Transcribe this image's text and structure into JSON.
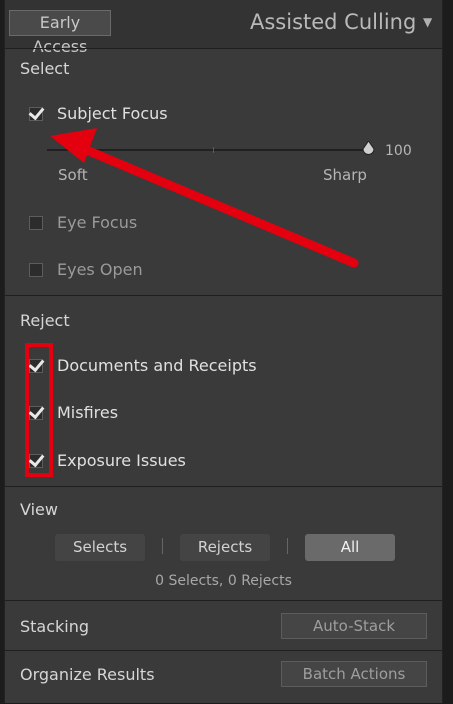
{
  "header": {
    "badge": "Early Access",
    "title": "Assisted Culling",
    "collapse_glyph": "▼"
  },
  "select": {
    "label": "Select",
    "items": [
      {
        "label": "Subject Focus",
        "checked": true,
        "enabled": true
      },
      {
        "label": "Eye Focus",
        "checked": false,
        "enabled": false
      },
      {
        "label": "Eyes Open",
        "checked": false,
        "enabled": false
      }
    ],
    "slider": {
      "value_label": "100",
      "value": 100,
      "min_label": "Soft",
      "max_label": "Sharp"
    }
  },
  "reject": {
    "label": "Reject",
    "items": [
      {
        "label": "Documents and Receipts",
        "checked": true
      },
      {
        "label": "Misfires",
        "checked": true
      },
      {
        "label": "Exposure Issues",
        "checked": true
      }
    ]
  },
  "view": {
    "label": "View",
    "buttons": [
      {
        "label": "Selects",
        "active": false
      },
      {
        "label": "Rejects",
        "active": false
      },
      {
        "label": "All",
        "active": true
      }
    ],
    "summary": "0 Selects, 0 Rejects"
  },
  "stacking": {
    "label": "Stacking",
    "button": "Auto-Stack"
  },
  "organize": {
    "label": "Organize Results",
    "button": "Batch Actions"
  },
  "annotation_color": "#e3000f"
}
